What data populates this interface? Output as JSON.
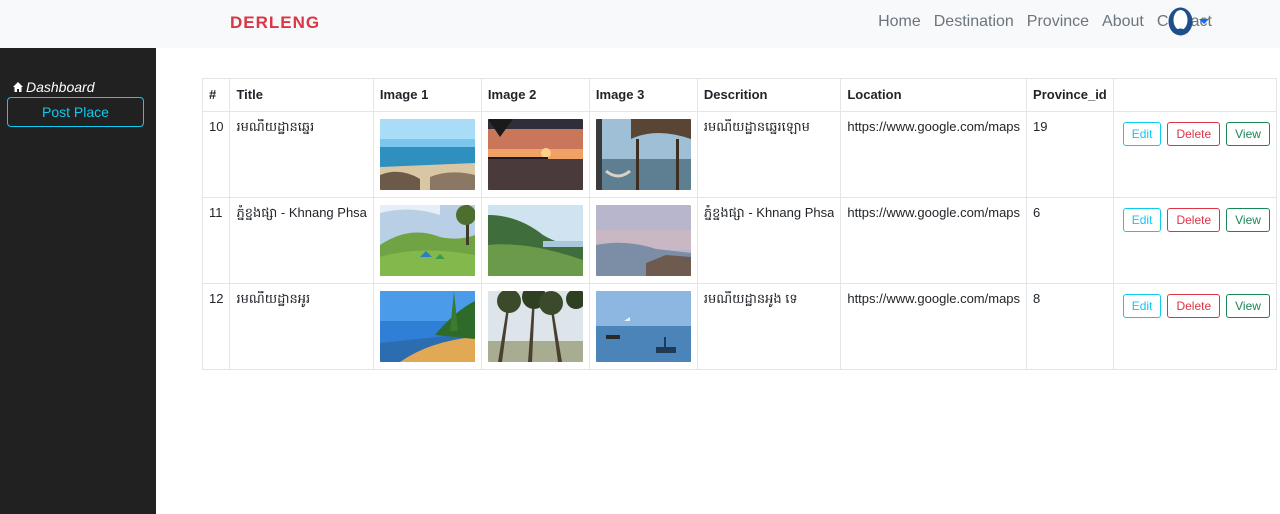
{
  "brand": "DERLENG",
  "nav": {
    "items": [
      "Home",
      "Destination",
      "Province",
      "About",
      "Contact"
    ]
  },
  "sidebar": {
    "dashboard": "Dashboard",
    "post_place": "Post Place"
  },
  "table": {
    "headers": [
      "#",
      "Title",
      "Image 1",
      "Image 2",
      "Image 3",
      "Descrition",
      "Location",
      "Province_id",
      ""
    ],
    "rows": [
      {
        "id": "10",
        "title": "រមណីយដ្ឋានឆ្នេរ",
        "desc": "រមណីយដ្ឋានឆ្នេរឡោម",
        "location": "https://www.google.com/maps",
        "province_id": "19"
      },
      {
        "id": "11",
        "title": "ភ្នំខ្នងផ្សា - Khnang Phsa",
        "desc": "ភ្នំខ្នងផ្សា - Khnang Phsa",
        "location": "https://www.google.com/maps",
        "province_id": "6"
      },
      {
        "id": "12",
        "title": "រមណីយដ្ឋានអូរ",
        "desc": "រមណីយដ្ឋានអូង ទេ",
        "location": "https://www.google.com/maps",
        "province_id": "8"
      }
    ],
    "actions": {
      "edit": "Edit",
      "delete": "Delete",
      "view": "View"
    }
  },
  "colors": {
    "brand": "#dc3545",
    "sidebar_bg": "#212121",
    "accent": "#0dcaf0",
    "danger": "#dc3545",
    "success": "#198754"
  }
}
